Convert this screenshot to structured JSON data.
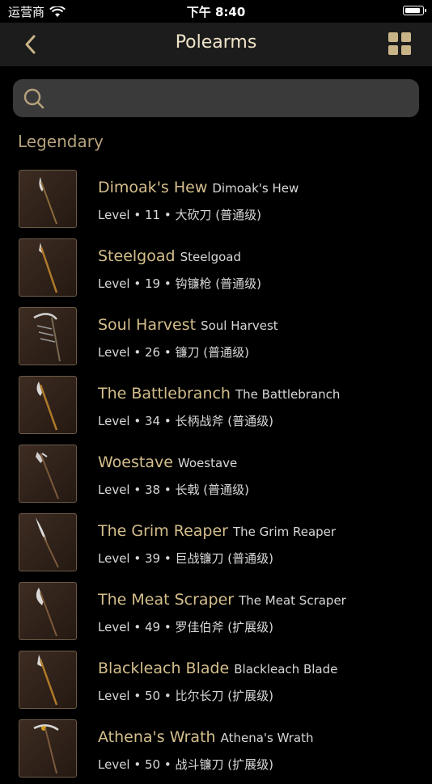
{
  "status": {
    "carrier": "运营商",
    "time": "下午 8:40"
  },
  "nav": {
    "title": "Polearms"
  },
  "search": {
    "placeholder": ""
  },
  "section": {
    "title": "Legendary"
  },
  "items": [
    {
      "name": "Dimoak's Hew",
      "sub": "Dimoak's Hew",
      "meta": "Level • 11 • 大砍刀 (普通级)"
    },
    {
      "name": "Steelgoad",
      "sub": "Steelgoad",
      "meta": "Level • 19 • 钩镰枪 (普通级)"
    },
    {
      "name": "Soul Harvest",
      "sub": "Soul Harvest",
      "meta": "Level • 26 • 镰刀 (普通级)"
    },
    {
      "name": "The Battlebranch",
      "sub": "The Battlebranch",
      "meta": "Level • 34 • 长柄战斧 (普通级)"
    },
    {
      "name": "Woestave",
      "sub": "Woestave",
      "meta": "Level • 38 • 长戟 (普通级)"
    },
    {
      "name": "The Grim Reaper",
      "sub": "The Grim Reaper",
      "meta": "Level • 39 • 巨战镰刀 (普通级)"
    },
    {
      "name": "The Meat Scraper",
      "sub": "The Meat Scraper",
      "meta": "Level • 49 • 罗佳伯斧 (扩展级)"
    },
    {
      "name": "Blackleach Blade",
      "sub": "Blackleach Blade",
      "meta": "Level • 50 • 比尔长刀 (扩展级)"
    },
    {
      "name": "Athena's Wrath",
      "sub": "Athena's Wrath",
      "meta": "Level • 50 • 战斗镰刀 (扩展级)"
    }
  ]
}
